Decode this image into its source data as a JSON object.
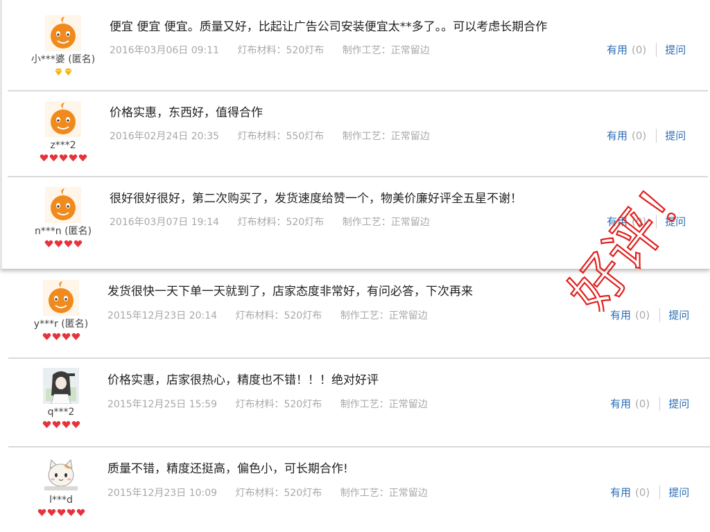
{
  "reviews": [
    {
      "username": "小***婆 (匿名)",
      "content": "便宜 便宜 便宜。质量又好，比起让广告公司安装便宜太**多了。。可以考虑长期合作",
      "date": "2016年03月06日 09:11",
      "material": "灯布材料：520灯布",
      "process": "制作工艺：正常留边",
      "useful_label": "有用",
      "useful_count": "(0)",
      "ask_label": "提问",
      "badge_type": "diamond",
      "badge_count": 2,
      "avatar_type": "default"
    },
    {
      "username": "z***2",
      "content": "价格实惠，东西好，值得合作",
      "date": "2016年02月24日 20:35",
      "material": "灯布材料：550灯布",
      "process": "制作工艺：正常留边",
      "useful_label": "有用",
      "useful_count": "(0)",
      "ask_label": "提问",
      "badge_type": "heart",
      "badge_count": 5,
      "avatar_type": "default"
    },
    {
      "username": "n***n (匿名)",
      "content": "很好很好很好，第二次购买了，发货速度给赞一个，物美价廉好评全五星不谢！",
      "date": "2016年03月07日 19:14",
      "material": "灯布材料：520灯布",
      "process": "制作工艺：正常留边",
      "useful_label": "有用",
      "useful_count": "(0)",
      "ask_label": "提问",
      "badge_type": "heart",
      "badge_count": 4,
      "avatar_type": "default"
    },
    {
      "username": "y***r (匿名)",
      "content": "发货很快一天下单一天就到了，店家态度非常好，有问必答，下次再来",
      "date": "2015年12月23日 20:14",
      "material": "灯布材料：520灯布",
      "process": "制作工艺：正常留边",
      "useful_label": "有用",
      "useful_count": "(0)",
      "ask_label": "提问",
      "badge_type": "heart",
      "badge_count": 4,
      "avatar_type": "default"
    },
    {
      "username": "q***2",
      "content": "价格实惠，店家很热心，精度也不错！！！绝对好评",
      "date": "2015年12月25日 15:59",
      "material": "灯布材料：520灯布",
      "process": "制作工艺：正常留边",
      "useful_label": "有用",
      "useful_count": "(0)",
      "ask_label": "提问",
      "badge_type": "heart",
      "badge_count": 4,
      "avatar_type": "anime"
    },
    {
      "username": "l***d",
      "content": "质量不错，精度还挺高，偏色小，可长期合作!",
      "date": "2015年12月23日 10:09",
      "material": "灯布材料：520灯布",
      "process": "制作工艺：正常留边",
      "useful_label": "有用",
      "useful_count": "(0)",
      "ask_label": "提问",
      "badge_type": "heart",
      "badge_count": 5,
      "avatar_type": "cat"
    }
  ],
  "stamp_text": "好评！",
  "colors": {
    "link": "#2a6db5",
    "meta_text": "#a8a8a8",
    "stamp": "#e0201e",
    "avatar_orange": "#f08a1c",
    "badge_red": "#e8323a",
    "badge_gold": "#f5b400"
  }
}
